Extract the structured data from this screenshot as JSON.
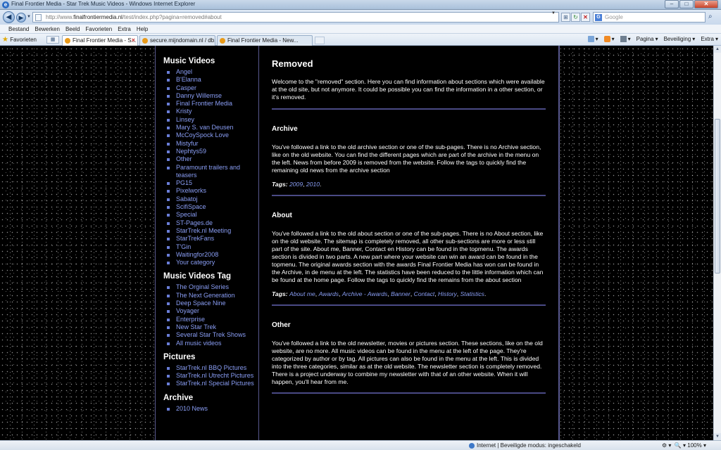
{
  "window": {
    "title": "Final Frontier Media - Star Trek Music Videos - Windows Internet Explorer",
    "min_symbol": "–",
    "max_symbol": "□",
    "close_symbol": "✕"
  },
  "address": {
    "url_prefix": "http://www.",
    "url_domain": "finalfrontiermedia.nl",
    "url_rest": "/test/index.php?pagina=removed#about",
    "search_placeholder": "Google"
  },
  "menu": [
    "Bestand",
    "Bewerken",
    "Beeld",
    "Favorieten",
    "Extra",
    "Help"
  ],
  "tabs": {
    "favorites_label": "Favorieten",
    "items": [
      {
        "label": "Final Frontier Media - S..."
      },
      {
        "label": "secure.mijndomain.nl / db..."
      },
      {
        "label": "Final Frontier Media - New..."
      }
    ]
  },
  "commands": {
    "page": "Pagina",
    "safety": "Beveiliging",
    "tools": "Extra"
  },
  "sidebar": {
    "music_videos": {
      "heading": "Music Videos",
      "items": [
        "Angel",
        "B'Elanna",
        "Casper",
        "Danny Willemse",
        "Final Frontier Media",
        "Kristy",
        "Linsey",
        "Mary S. van Deusen",
        "McCoySpock Love",
        "Mistyfur",
        "Nephtys59",
        "Other",
        "Paramount trailers and teasers",
        "PG15",
        "Pixelworks",
        "Sabatoj",
        "ScifiSpace",
        "Special",
        "ST-Pages.de",
        "StarTrek.nl Meeting",
        "StarTrekFans",
        "T'Gin",
        "Waitingfor2008",
        "Your category"
      ]
    },
    "music_videos_tag": {
      "heading": "Music Videos Tag",
      "items": [
        "The Orginal Series",
        "The Next Generation",
        "Deep Space Nine",
        "Voyager",
        "Enterprise",
        "New Star Trek",
        "Several Star Trek Shows",
        "All music videos"
      ]
    },
    "pictures": {
      "heading": "Pictures",
      "items": [
        "StarTrek.nl BBQ Pictures",
        "StarTrek.nl Utrecht Pictures",
        "StarTrek.nl Special Pictures"
      ]
    },
    "archive": {
      "heading": "Archive",
      "items": [
        "2010 News"
      ]
    }
  },
  "main": {
    "title": "Removed",
    "intro": "Welcome to the \"removed\" section. Here you can find information about sections which were available at the old site, but not anymore. It could be possible you can find the information in a other section, or it's removed.",
    "sections": [
      {
        "title": "Archive",
        "body": "You've followed a link to the old archive section or one of the sub-pages. There is no Archive section, like on the old website. You can find the different pages which are part of the archive in the menu on the left. News from before 2009 is removed from the website. Follow the tags to quickly find the remaining old news from the archive section",
        "tags_label": "Tags:",
        "tags": [
          "2009",
          "2010"
        ]
      },
      {
        "title": "About",
        "body": "You've followed a link to the old about section or one of the sub-pages. There is no About section, like on the old website. The sitemap is completely removed, all other sub-sections are more or less still part of the site. About me, Banner, Contact en History can be found in the topmenu. The awards section is divided in two parts. A new part where your website can win an award can be found in the topmenu. The original awards section with the awards Final Frontier Media has won can be found in the Archive, in de menu at the left. The statistics have been reduced to the little information which can be found at the home page. Follow the tags to quickly find the remains from the about section",
        "tags_label": "Tags:",
        "tags": [
          "About me",
          "Awards",
          "Archive - Awards",
          "Banner",
          "Contact",
          "History",
          "Statistics"
        ]
      },
      {
        "title": "Other",
        "body": "You've followed a link to the old newsletter, movies or pictures section. These sections, like on the old website, are no more. All music videos can be found in the menu at the left of the page. They're categorized by author or by tag. All pictures can also be found in the menu at the left. This is divided into the three categories, similar as at the old website. The newsletter section is completely removed. There is a project underway to combine my newsletter with that of an other website. When it will happen, you'll hear from me."
      }
    ]
  },
  "status": {
    "zone": "Internet | Beveiligde modus: ingeschakeld",
    "zoom": "100%"
  },
  "colors": {
    "link": "#8a9ef5",
    "border": "#58588e",
    "background": "#000000"
  }
}
